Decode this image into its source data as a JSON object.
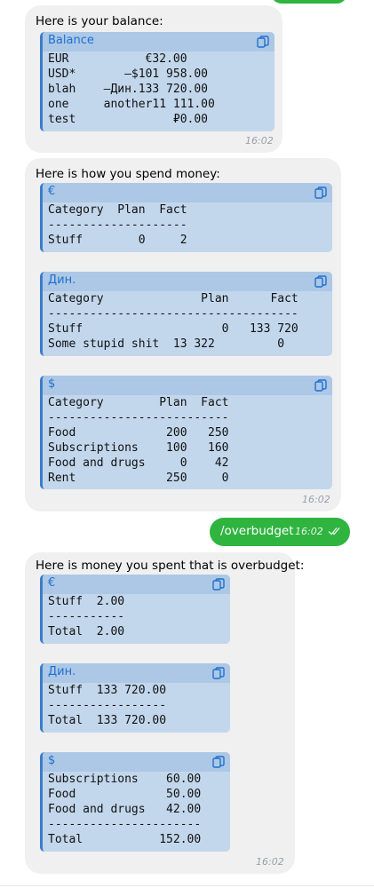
{
  "messages": {
    "balance": {
      "text": "Here is your balance:",
      "block": {
        "lang": "Balance",
        "lines": [
          "EUR           €32.00",
          "USD*       –$101 958.00",
          "blah    –Дин.133 720.00",
          "one     another11 111.00",
          "test              ₽0.00"
        ]
      },
      "time": "16:02"
    },
    "spend": {
      "text": "Here is how you spend money:",
      "blocks": [
        {
          "lang": "€",
          "lines": [
            "Category  Plan  Fact",
            "--------------------",
            "Stuff        0     2"
          ]
        },
        {
          "lang": "Дин.",
          "lines": [
            "Category              Plan      Fact",
            "------------------------------------",
            "Stuff                    0   133 720",
            "Some stupid shit  13 322         0"
          ]
        },
        {
          "lang": "$",
          "lines": [
            "Category        Plan  Fact",
            "--------------------------",
            "Food             200   250",
            "Subscriptions    100   160",
            "Food and drugs     0    42",
            "Rent             250     0"
          ]
        }
      ],
      "time": "16:02"
    },
    "outgoing": {
      "text": "/overbudget",
      "time": "16:02"
    },
    "overbudget": {
      "text": "Here is money you spent that is overbudget:",
      "blocks": [
        {
          "lang": "€",
          "lines": [
            "Stuff  2.00",
            "-----------",
            "Total  2.00"
          ]
        },
        {
          "lang": "Дин.",
          "lines": [
            "Stuff  133 720.00",
            "-----------------",
            "Total  133 720.00"
          ]
        },
        {
          "lang": "$",
          "lines": [
            "Subscriptions    60.00",
            "Food             50.00",
            "Food and drugs   42.00",
            "----------------------",
            "Total           152.00"
          ]
        }
      ],
      "time": "16:02"
    }
  },
  "icons": {
    "copy": "copy-icon",
    "read": "double-check-icon"
  },
  "colors": {
    "outgoing_bubble": "#2fb43f",
    "incoming_bubble": "#f0f0f1",
    "code_bg": "#c3d7ec",
    "code_header": "#acc8e6",
    "code_lang": "#1f6fce"
  }
}
